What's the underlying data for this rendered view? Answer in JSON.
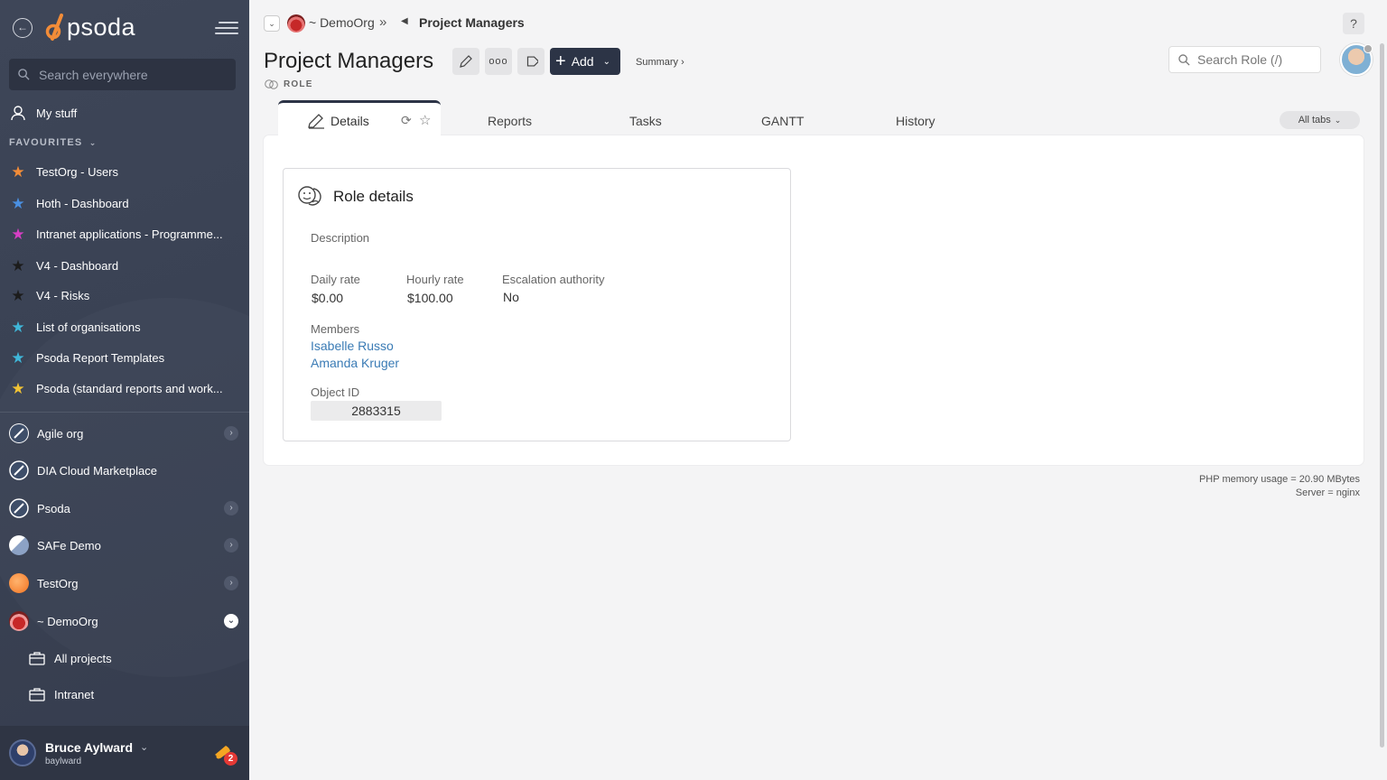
{
  "sidebar": {
    "logo_text": "psoda",
    "search_placeholder": "Search everywhere",
    "my_stuff": "My stuff",
    "favourites_heading": "FAVOURITES",
    "favourites": [
      {
        "label": "TestOrg - Users",
        "color": "#f28c38"
      },
      {
        "label": "Hoth - Dashboard",
        "color": "#4a90e2"
      },
      {
        "label": "Intranet applications - Programme...",
        "color": "#d63fc4"
      },
      {
        "label": "V4 - Dashboard",
        "color": "#222222"
      },
      {
        "label": "V4 - Risks",
        "color": "#222222"
      },
      {
        "label": "List of organisations",
        "color": "#3fb7d9"
      },
      {
        "label": "Psoda Report Templates",
        "color": "#3fb7d9"
      },
      {
        "label": "Psoda (standard reports and work...",
        "color": "#f2c230"
      }
    ],
    "orgs": [
      {
        "label": "Agile org",
        "expandable": true
      },
      {
        "label": "DIA Cloud Marketplace",
        "expandable": false
      },
      {
        "label": "Psoda",
        "expandable": true
      },
      {
        "label": "SAFe Demo",
        "expandable": true
      },
      {
        "label": "TestOrg",
        "expandable": true
      },
      {
        "label": "~ DemoOrg",
        "expandable": true,
        "open": true
      }
    ],
    "sub_items": [
      "All projects",
      "Intranet"
    ],
    "user": {
      "name": "Bruce Aylward",
      "login": "baylward",
      "notifications": "2"
    }
  },
  "breadcrumb": {
    "org": "~ DemoOrg",
    "separator": "»",
    "current": "Project Managers"
  },
  "header": {
    "title": "Project Managers",
    "type_label": "ROLE",
    "add_label": "Add",
    "summary_label": "Summary ›",
    "search_placeholder": "Search Role (/)",
    "help": "?"
  },
  "tabs": {
    "active": "Details",
    "items": [
      "Reports",
      "Tasks",
      "GANTT",
      "History"
    ],
    "all_tabs": "All tabs"
  },
  "role_details": {
    "title": "Role details",
    "description_label": "Description",
    "daily_rate_label": "Daily rate",
    "daily_rate": "$0.00",
    "hourly_rate_label": "Hourly rate",
    "hourly_rate": "$100.00",
    "escalation_label": "Escalation authority",
    "escalation": "No",
    "members_label": "Members",
    "members": [
      "Isabelle Russo",
      "Amanda Kruger"
    ],
    "object_id_label": "Object ID",
    "object_id": "2883315"
  },
  "footer": {
    "memory": "PHP memory usage = 20.90 MBytes",
    "server": "Server = nginx"
  },
  "colors": {
    "sidebar_bg": "#3a4254",
    "accent_dark": "#2c3446",
    "link": "#3a7bb5"
  }
}
